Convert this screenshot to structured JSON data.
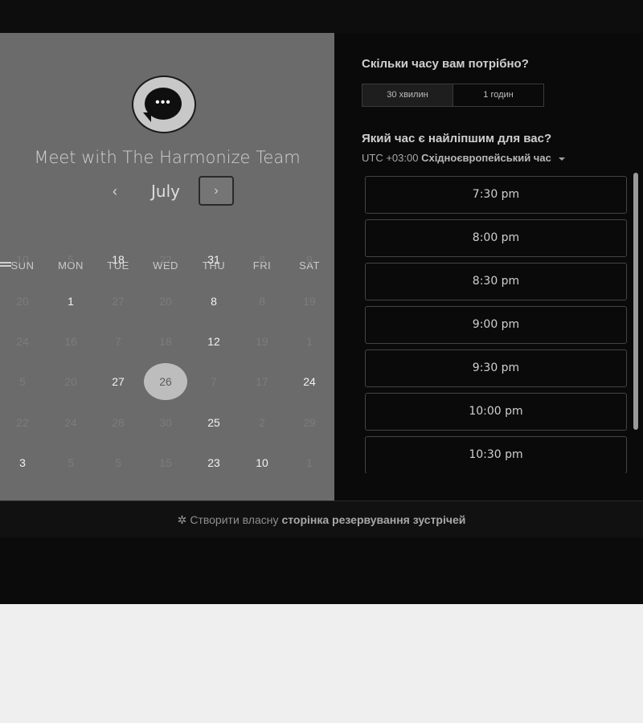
{
  "scheduler": {
    "title": "Meet with The Harmonize Team",
    "logo_icon": "chat-bubble-icon",
    "logo_glyph": "•••",
    "month": "July",
    "prev_glyph": "‹",
    "next_glyph": "›",
    "weekdays": [
      "SUN",
      "MON",
      "TUE",
      "WED",
      "THU",
      "FRI",
      "SAT"
    ],
    "weeks": [
      [
        {
          "d": "10",
          "a": false
        },
        {
          "d": "5",
          "a": false
        },
        {
          "d": "18",
          "a": true
        },
        {
          "d": "22",
          "a": false
        },
        {
          "d": "31",
          "a": true
        },
        {
          "d": "8",
          "a": false
        },
        {
          "d": "9",
          "a": false
        }
      ],
      [
        {
          "d": "20",
          "a": false
        },
        {
          "d": "1",
          "a": true
        },
        {
          "d": "27",
          "a": false
        },
        {
          "d": "20",
          "a": false
        },
        {
          "d": "8",
          "a": true
        },
        {
          "d": "8",
          "a": false
        },
        {
          "d": "19",
          "a": false
        }
      ],
      [
        {
          "d": "24",
          "a": false
        },
        {
          "d": "16",
          "a": false
        },
        {
          "d": "7",
          "a": false
        },
        {
          "d": "18",
          "a": false
        },
        {
          "d": "12",
          "a": true
        },
        {
          "d": "19",
          "a": false
        },
        {
          "d": "1",
          "a": false
        }
      ],
      [
        {
          "d": "5",
          "a": false
        },
        {
          "d": "20",
          "a": false
        },
        {
          "d": "27",
          "a": true
        },
        {
          "d": "26",
          "a": true,
          "selected": true
        },
        {
          "d": "7",
          "a": false
        },
        {
          "d": "17",
          "a": false
        },
        {
          "d": "24",
          "a": true
        }
      ],
      [
        {
          "d": "22",
          "a": false
        },
        {
          "d": "24",
          "a": false
        },
        {
          "d": "28",
          "a": false
        },
        {
          "d": "30",
          "a": false
        },
        {
          "d": "25",
          "a": true
        },
        {
          "d": "2",
          "a": false
        },
        {
          "d": "29",
          "a": false
        }
      ],
      [
        {
          "d": "3",
          "a": true
        },
        {
          "d": "5",
          "a": false
        },
        {
          "d": "5",
          "a": false
        },
        {
          "d": "15",
          "a": false
        },
        {
          "d": "23",
          "a": true
        },
        {
          "d": "10",
          "a": true
        },
        {
          "d": "1",
          "a": false
        }
      ]
    ]
  },
  "booking": {
    "duration_question": "Скільки часу вам потрібно?",
    "durations": [
      {
        "label": "30 хвилин",
        "active": true
      },
      {
        "label": "1 годин",
        "active": false
      }
    ],
    "time_question": "Який час є найліпшим для вас?",
    "timezone_offset": "UTC +03:00",
    "timezone_name": "Східноєвропейський час",
    "slots": [
      "7:30 pm",
      "8:00 pm",
      "8:30 pm",
      "9:00 pm",
      "9:30 pm",
      "10:00 pm",
      "10:30 pm"
    ]
  },
  "footer": {
    "icon": "hubspot-sprocket-icon",
    "icon_glyph": "✲",
    "text": "Створити власну",
    "bold": "сторінка резервування зустрічей"
  }
}
